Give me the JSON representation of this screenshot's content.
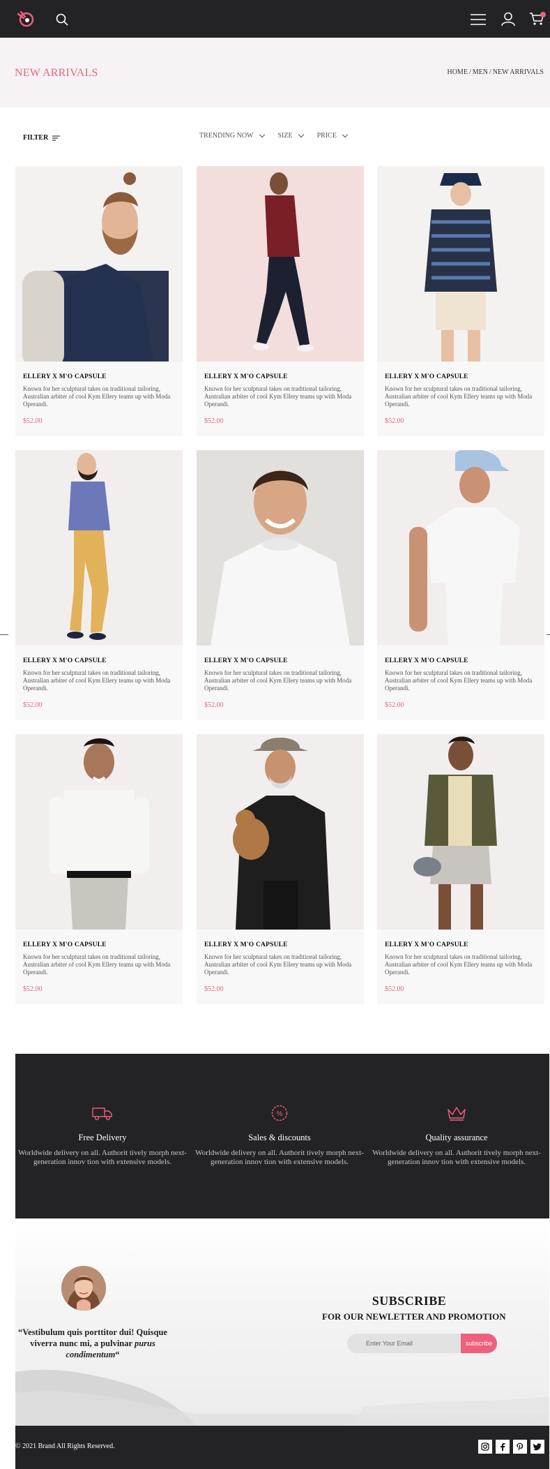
{
  "header": {
    "logo_icon": "hand-logo-icon",
    "search_icon": "search-icon",
    "menu_icon": "hamburger-menu-icon",
    "user_icon": "user-icon",
    "cart_icon": "cart-icon",
    "accent": "#f0607c",
    "bar_color": "#232325"
  },
  "page": {
    "title": "NEW ARRIVALS",
    "breadcrumb": [
      "HOME",
      "MEN",
      "NEW ARRIVALS"
    ],
    "breadcrumb_sep": "/"
  },
  "filters": {
    "filter_label": "FILTER",
    "sort_options": [
      "TRENDING NOW",
      "SIZE",
      "PRICE"
    ]
  },
  "products": [
    {
      "name": "ELLERY X M'O CAPSULE",
      "desc": "Known for her sculptural takes on traditional tailoring, Australian arbiter of cool Kym Ellery teams up with Moda Operandi.",
      "price": "$52.00",
      "bg": "#f4f1f1"
    },
    {
      "name": "ELLERY X M'O CAPSULE",
      "desc": "Known for her sculptural takes on traditional tailoring, Australian arbiter of cool Kym Ellery teams up with Moda Operandi.",
      "price": "$52.00",
      "bg": "#f3dedd"
    },
    {
      "name": "ELLERY X M'O CAPSULE",
      "desc": "Known for her sculptural takes on traditional tailoring, Australian arbiter of cool Kym Ellery teams up with Moda Operandi.",
      "price": "$52.00",
      "bg": "#f4f1f1"
    },
    {
      "name": "ELLERY X M'O CAPSULE",
      "desc": "Known for her sculptural takes on traditional tailoring, Australian arbiter of cool Kym Ellery teams up with Moda Operandi.",
      "price": "$52.00",
      "bg": "#f3eeee"
    },
    {
      "name": "ELLERY X M'O CAPSULE",
      "desc": "Known for her sculptural takes on traditional tailoring, Australian arbiter of cool Kym Ellery teams up with Moda Operandi.",
      "price": "$52.00",
      "bg": "#e2e0dc"
    },
    {
      "name": "ELLERY X M'O CAPSULE",
      "desc": "Known for her sculptural takes on traditional tailoring, Australian arbiter of cool Kym Ellery teams up with Moda Operandi.",
      "price": "$52.00",
      "bg": "#f3eeee"
    },
    {
      "name": "ELLERY X M'O CAPSULE",
      "desc": "Known for her sculptural takes on traditional tailoring, Australian arbiter of cool Kym Ellery teams up with Moda Operandi.",
      "price": "$52.00",
      "bg": "#f3eeee"
    },
    {
      "name": "ELLERY X M'O CAPSULE",
      "desc": "Known for her sculptural takes on traditional tailoring, Australian arbiter of cool Kym Ellery teams up with Moda Operandi.",
      "price": "$52.00",
      "bg": "#f3eeee"
    },
    {
      "name": "ELLERY X M'O CAPSULE",
      "desc": "Known for her sculptural takes on traditional tailoring, Australian arbiter of cool Kym Ellery teams up with Moda Operandi.",
      "price": "$52.00",
      "bg": "#f3eeee"
    }
  ],
  "features": [
    {
      "icon": "delivery-truck-icon",
      "title": "Free Delivery",
      "desc": "Worldwide delivery on all. Authorit tively morph next-generation innov tion with extensive models."
    },
    {
      "icon": "discount-badge-icon",
      "title": "Sales & discounts",
      "desc": "Worldwide delivery on all. Authorit tively morph next-generation innov tion with extensive models."
    },
    {
      "icon": "crown-icon",
      "title": "Quality assurance",
      "desc": "Worldwide delivery on all. Authorit tively morph next-generation innov tion with extensive models."
    }
  ],
  "testimonial": {
    "quote_open": "“Vestibulum quis porttitor dui! Quisque viverra nunc mi, a pulvinar ",
    "quote_em": "purus condimentum",
    "quote_close": "“"
  },
  "subscribe": {
    "title": "SUBSCRIBE",
    "subtitle": "FOR OUR NEWLETTER AND PROMOTION",
    "placeholder": "Enter Your Email",
    "button": "subscribe"
  },
  "footer": {
    "copyright": "© 2021 Brand All Rights Reserved.",
    "social": [
      "instagram-icon",
      "facebook-icon",
      "pinterest-icon",
      "twitter-icon"
    ]
  }
}
